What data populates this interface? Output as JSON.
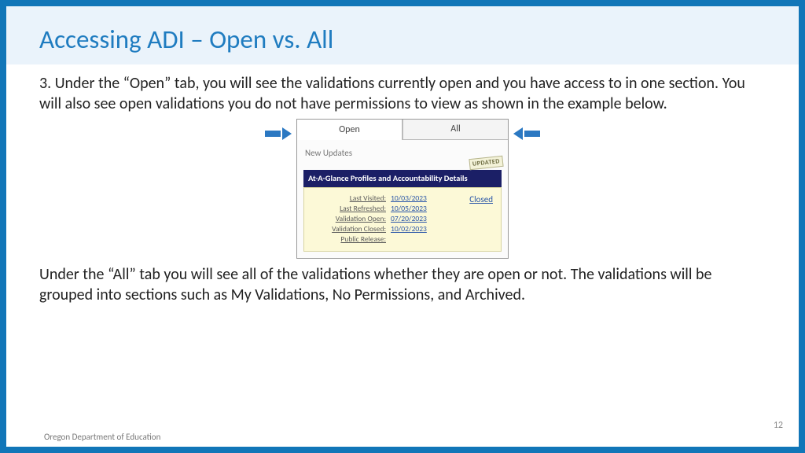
{
  "title": "Accessing ADI – Open vs. All",
  "paragraph1": "3. Under the “Open” tab, you will see the validations currently open and you have access to in one section. You will also see open validations you do not have permissions to view as shown in the example below.",
  "paragraph2": "Under the “All” tab you will see all of the validations whether they are open or not. The validations will be grouped into sections such as My Validations, No Permissions, and Archived.",
  "tabs": {
    "open": "Open",
    "all": "All"
  },
  "panel": {
    "new_updates": "New Updates",
    "updated_badge": "UPDATED",
    "banner": "At-A-Glance Profiles and Accountability Details",
    "closed": "Closed",
    "rows": [
      {
        "label": "Last Visited:",
        "value": "10/03/2023"
      },
      {
        "label": "Last Refreshed:",
        "value": "10/05/2023"
      },
      {
        "label": "Validation Open:",
        "value": "07/20/2023"
      },
      {
        "label": "Validation Closed:",
        "value": "10/02/2023"
      },
      {
        "label": "Public Release:",
        "value": ""
      }
    ]
  },
  "footer": "Oregon Department of Education",
  "page_number": "12"
}
